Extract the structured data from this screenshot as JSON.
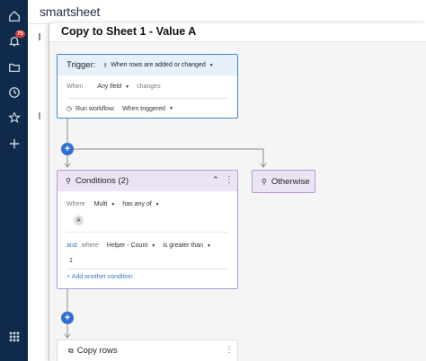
{
  "nav": {
    "icons": [
      "home-icon",
      "bell-icon",
      "folder-icon",
      "clock-icon",
      "star-icon",
      "plus-icon",
      "apps-grid-icon"
    ],
    "notification_count": "75"
  },
  "app": {
    "brand": "smartsheet"
  },
  "modal": {
    "title": "Copy to Sheet 1 - Value A"
  },
  "trigger": {
    "label": "Trigger:",
    "event": "When rows are added or changed",
    "when_label": "When",
    "field": "Any field",
    "changes": "changes",
    "run_label": "Run workflow:",
    "run_value": "When triggered"
  },
  "conditions": {
    "title": "Conditions (2)",
    "rows": [
      {
        "prefix": "Where",
        "field": "Multi",
        "operator": "has any of",
        "chip": "A"
      },
      {
        "conj": "and",
        "prefix": "where",
        "field": "Helper - Count",
        "operator": "is greater than",
        "value": "1"
      }
    ],
    "add_label": "+ Add another condition"
  },
  "otherwise": {
    "label": "Otherwise"
  },
  "action": {
    "label": "Copy rows"
  },
  "colors": {
    "nav": "#0f2a4a",
    "accent": "#2f6fd3",
    "trigger_border": "#3a86d6",
    "condition_border": "#b59bd6"
  }
}
